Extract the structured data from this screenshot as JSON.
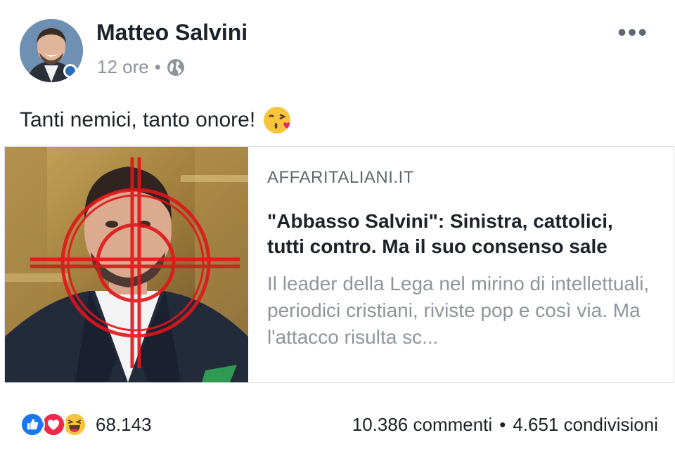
{
  "post": {
    "author": "Matteo Salvini",
    "time": "12 ore",
    "separator": "•",
    "text": "Tanti nemici, tanto onore!",
    "emoji": "kissing-wink-emoji"
  },
  "link": {
    "domain": "AFFARITALIANI.IT",
    "headline": "\"Abbasso Salvini\": Sinistra, cattolici, tutti contro. Ma il suo consenso sale",
    "description": "Il leader della Lega nel mirino di intellettuali, periodici cristiani, riviste pop e così via. Ma l'attacco risulta sc..."
  },
  "footer": {
    "reaction_icons": [
      "like-icon",
      "love-icon",
      "haha-icon"
    ],
    "reactions_count": "68.143",
    "comments": "10.386 commenti",
    "stats_separator": "•",
    "shares": "4.651 condivisioni"
  },
  "colors": {
    "like": "#1877f2",
    "love": "#f0284a",
    "haha": "#f7c53d",
    "crosshair": "#e0161b"
  }
}
